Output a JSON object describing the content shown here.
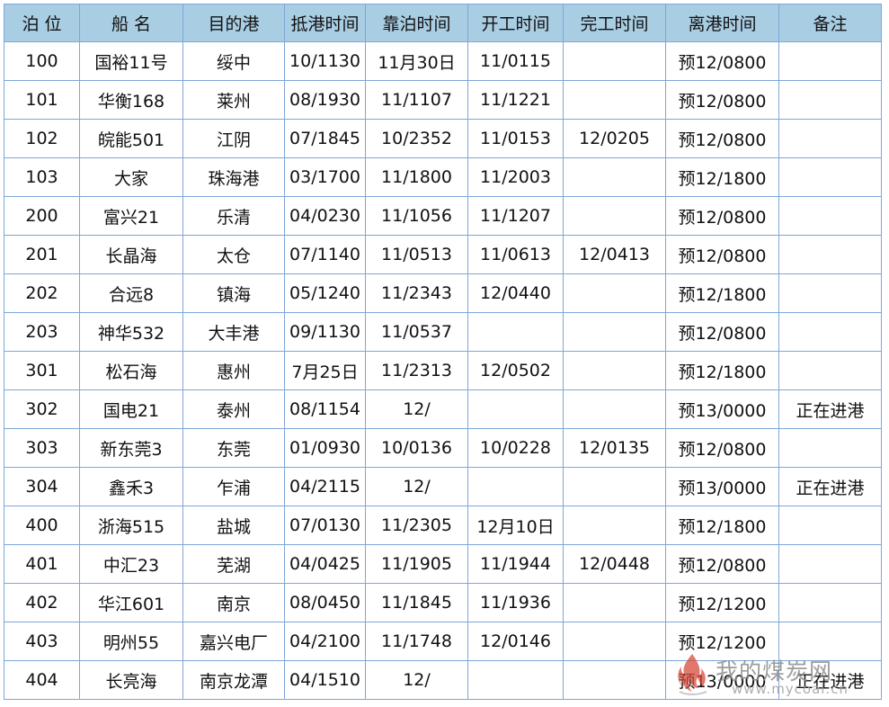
{
  "headers": [
    "泊 位",
    "船 名",
    "目的港",
    "抵港时间",
    "靠泊时间",
    "开工时间",
    "完工时间",
    "离港时间",
    "备注"
  ],
  "rows": [
    [
      "100",
      "国裕11号",
      "绥中",
      "10/1130",
      "11月30日",
      "11/0115",
      "",
      "预12/0800",
      ""
    ],
    [
      "101",
      "华衡168",
      "莱州",
      "08/1930",
      "11/1107",
      "11/1221",
      "",
      "预12/0800",
      ""
    ],
    [
      "102",
      "皖能501",
      "江阴",
      "07/1845",
      "10/2352",
      "11/0153",
      "12/0205",
      "预12/0800",
      ""
    ],
    [
      "103",
      "大家",
      "珠海港",
      "03/1700",
      "11/1800",
      "11/2003",
      "",
      "预12/1800",
      ""
    ],
    [
      "200",
      "富兴21",
      "乐清",
      "04/0230",
      "11/1056",
      "11/1207",
      "",
      "预12/0800",
      ""
    ],
    [
      "201",
      "长晶海",
      "太仓",
      "07/1140",
      "11/0513",
      "11/0613",
      "12/0413",
      "预12/0800",
      ""
    ],
    [
      "202",
      "合远8",
      "镇海",
      "05/1240",
      "11/2343",
      "12/0440",
      "",
      "预12/1800",
      ""
    ],
    [
      "203",
      "神华532",
      "大丰港",
      "09/1130",
      "11/0537",
      "",
      "",
      "预12/0800",
      ""
    ],
    [
      "301",
      "松石海",
      "惠州",
      "7月25日",
      "11/2313",
      "12/0502",
      "",
      "预12/1800",
      ""
    ],
    [
      "302",
      "国电21",
      "泰州",
      "08/1154",
      "12/",
      "",
      "",
      "预13/0000",
      "正在进港"
    ],
    [
      "303",
      "新东莞3",
      "东莞",
      "01/0930",
      "10/0136",
      "10/0228",
      "12/0135",
      "预12/0800",
      ""
    ],
    [
      "304",
      "鑫禾3",
      "乍浦",
      "04/2115",
      "12/",
      "",
      "",
      "预13/0000",
      "正在进港"
    ],
    [
      "400",
      "浙海515",
      "盐城",
      "07/0130",
      "11/2305",
      "12月10日",
      "",
      "预12/1800",
      ""
    ],
    [
      "401",
      "中汇23",
      "芜湖",
      "04/0425",
      "11/1905",
      "11/1944",
      "12/0448",
      "预12/0800",
      ""
    ],
    [
      "402",
      "华江601",
      "南京",
      "08/0450",
      "11/1845",
      "11/1936",
      "",
      "预12/1200",
      ""
    ],
    [
      "403",
      "明州55",
      "嘉兴电厂",
      "04/2100",
      "11/1748",
      "12/0146",
      "",
      "预12/1200",
      ""
    ],
    [
      "404",
      "长亮海",
      "南京龙潭",
      "04/1510",
      "12/",
      "",
      "",
      "预13/0000",
      "正在进港"
    ]
  ],
  "watermark": {
    "title": "我的煤炭网",
    "url": "www.mycoal.cn",
    "logo_icon": "flame-logo-icon",
    "logo_color": "#d84a3a"
  }
}
